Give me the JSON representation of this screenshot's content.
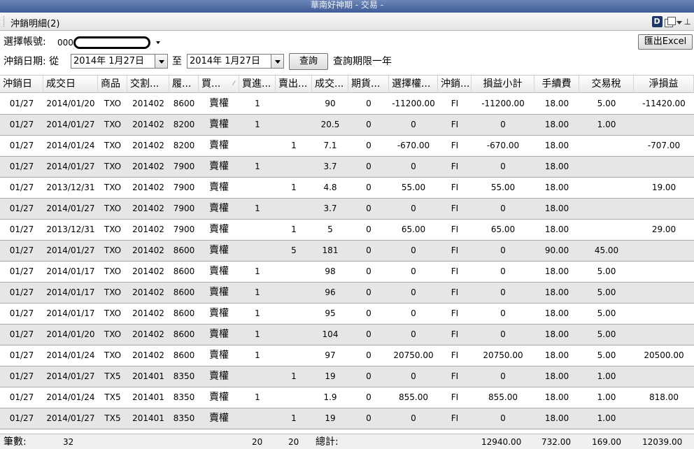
{
  "window": {
    "title": "華南好神期 - 交易 -"
  },
  "tab": {
    "title": "沖銷明細(2)"
  },
  "toolbar_icons": {
    "d_label": "D"
  },
  "export_button": "匯出Excel",
  "account": {
    "label": "選擇帳號:",
    "prefix": "000"
  },
  "date_filter": {
    "label": "沖銷日期: 從",
    "from": "2014年  1月27日",
    "to_label": "至",
    "to": "2014年  1月27日",
    "query_button": "查詢",
    "note": "查詢期限一年"
  },
  "columns": [
    "沖銷日",
    "成交日",
    "商品",
    "交割...",
    "履...",
    "買...",
    "買進...",
    "賣出...",
    "成交...",
    "期貨...",
    "選擇權...",
    "沖銷...",
    "損益小計",
    "手續費",
    "交易稅",
    "淨損益"
  ],
  "rows": [
    [
      "01/27",
      "2014/01/20",
      "TXO",
      "201402",
      "8600",
      "賣權",
      "1",
      "",
      "90",
      "0",
      "-11200.00",
      "FI",
      "-11200.00",
      "18.00",
      "5.00",
      "-11420.00"
    ],
    [
      "01/27",
      "2014/01/27",
      "TXO",
      "201402",
      "8200",
      "賣權",
      "1",
      "",
      "20.5",
      "0",
      "0",
      "FI",
      "0",
      "18.00",
      "1.00",
      ""
    ],
    [
      "01/27",
      "2014/01/24",
      "TXO",
      "201402",
      "8200",
      "賣權",
      "",
      "1",
      "7.1",
      "0",
      "-670.00",
      "FI",
      "-670.00",
      "18.00",
      "",
      "-707.00"
    ],
    [
      "01/27",
      "2014/01/27",
      "TXO",
      "201402",
      "7900",
      "賣權",
      "1",
      "",
      "3.7",
      "0",
      "0",
      "FI",
      "0",
      "18.00",
      "",
      ""
    ],
    [
      "01/27",
      "2013/12/31",
      "TXO",
      "201402",
      "7900",
      "賣權",
      "",
      "1",
      "4.8",
      "0",
      "55.00",
      "FI",
      "55.00",
      "18.00",
      "",
      "19.00"
    ],
    [
      "01/27",
      "2014/01/27",
      "TXO",
      "201402",
      "7900",
      "賣權",
      "1",
      "",
      "3.7",
      "0",
      "0",
      "FI",
      "0",
      "18.00",
      "",
      ""
    ],
    [
      "01/27",
      "2013/12/31",
      "TXO",
      "201402",
      "7900",
      "賣權",
      "",
      "1",
      "5",
      "0",
      "65.00",
      "FI",
      "65.00",
      "18.00",
      "",
      "29.00"
    ],
    [
      "01/27",
      "2014/01/27",
      "TXO",
      "201402",
      "8600",
      "賣權",
      "",
      "5",
      "181",
      "0",
      "0",
      "FI",
      "0",
      "90.00",
      "45.00",
      ""
    ],
    [
      "01/27",
      "2014/01/17",
      "TXO",
      "201402",
      "8600",
      "賣權",
      "1",
      "",
      "98",
      "0",
      "0",
      "FI",
      "0",
      "18.00",
      "5.00",
      ""
    ],
    [
      "01/27",
      "2014/01/17",
      "TXO",
      "201402",
      "8600",
      "賣權",
      "1",
      "",
      "96",
      "0",
      "0",
      "FI",
      "0",
      "18.00",
      "5.00",
      ""
    ],
    [
      "01/27",
      "2014/01/17",
      "TXO",
      "201402",
      "8600",
      "賣權",
      "1",
      "",
      "95",
      "0",
      "0",
      "FI",
      "0",
      "18.00",
      "5.00",
      ""
    ],
    [
      "01/27",
      "2014/01/20",
      "TXO",
      "201402",
      "8600",
      "賣權",
      "1",
      "",
      "104",
      "0",
      "0",
      "FI",
      "0",
      "18.00",
      "5.00",
      ""
    ],
    [
      "01/27",
      "2014/01/24",
      "TXO",
      "201402",
      "8600",
      "賣權",
      "1",
      "",
      "97",
      "0",
      "20750.00",
      "FI",
      "20750.00",
      "18.00",
      "5.00",
      "20500.00"
    ],
    [
      "01/27",
      "2014/01/27",
      "TX5",
      "201401",
      "8350",
      "賣權",
      "",
      "1",
      "19",
      "0",
      "0",
      "FI",
      "0",
      "18.00",
      "1.00",
      ""
    ],
    [
      "01/27",
      "2014/01/24",
      "TX5",
      "201401",
      "8350",
      "賣權",
      "1",
      "",
      "1.9",
      "0",
      "855.00",
      "FI",
      "855.00",
      "18.00",
      "1.00",
      "818.00"
    ],
    [
      "01/27",
      "2014/01/27",
      "TX5",
      "201401",
      "8350",
      "賣權",
      "",
      "1",
      "19",
      "0",
      "0",
      "FI",
      "0",
      "18.00",
      "1.00",
      ""
    ]
  ],
  "footer": {
    "count_label": "筆數:",
    "count": "32",
    "buy_total": "20",
    "sell_total": "20",
    "total_label": "總計:",
    "pnl_total": "12940.00",
    "fee_total": "732.00",
    "tax_total": "169.00",
    "net_total": "12039.00"
  }
}
